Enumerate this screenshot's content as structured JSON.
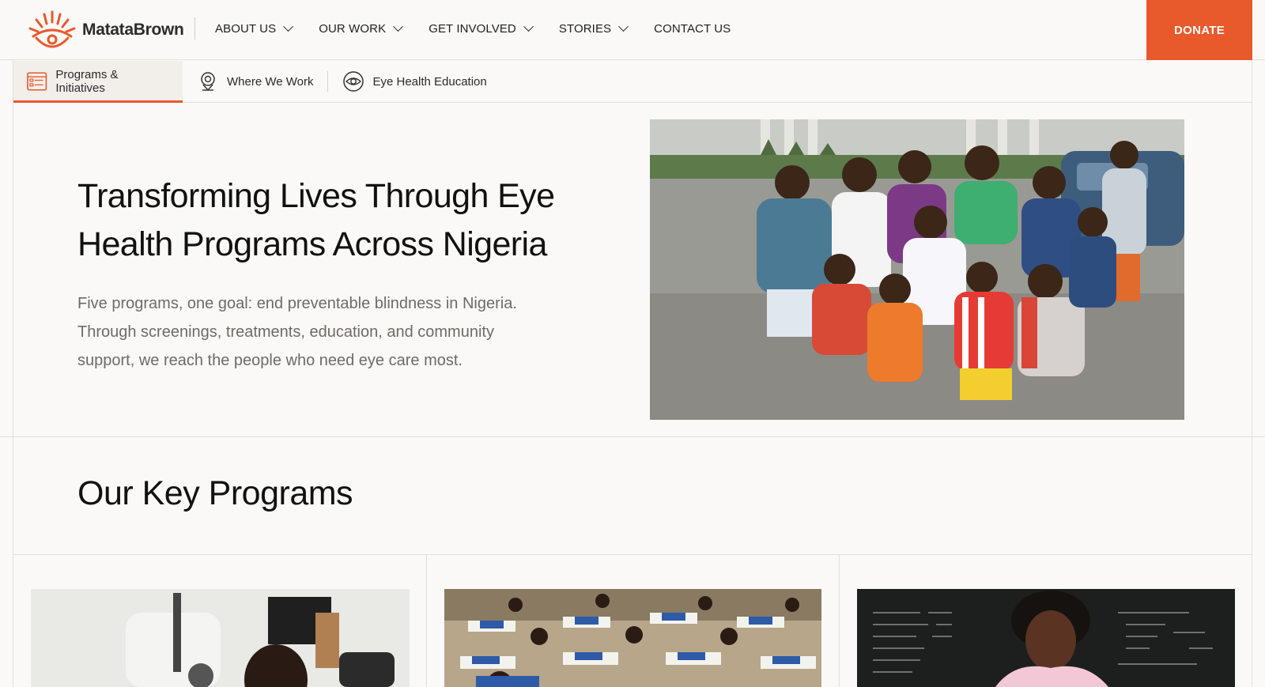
{
  "brand": {
    "name": "MatataBrown",
    "accent": "#e8592b"
  },
  "nav": {
    "items": [
      {
        "label": "ABOUT US",
        "dropdown": true
      },
      {
        "label": "OUR WORK",
        "dropdown": true
      },
      {
        "label": "GET INVOLVED",
        "dropdown": true
      },
      {
        "label": "STORIES",
        "dropdown": true
      },
      {
        "label": "CONTACT US",
        "dropdown": false
      }
    ],
    "donate_label": "DONATE"
  },
  "subnav": {
    "tabs": [
      {
        "label": "Programs & Initiatives",
        "icon": "list-icon",
        "active": true
      },
      {
        "label": "Where We Work",
        "icon": "map-pin-icon",
        "active": false
      },
      {
        "label": "Eye Health Education",
        "icon": "eye-icon",
        "active": false
      }
    ]
  },
  "hero": {
    "title": "Transforming Lives Through Eye Health Programs Across Nigeria",
    "text": "Five programs, one goal: end preventable blindness in Nigeria. Through screenings, treatments, education, and community support, we reach the people who need eye care most."
  },
  "programs": {
    "title": "Our Key Programs"
  }
}
